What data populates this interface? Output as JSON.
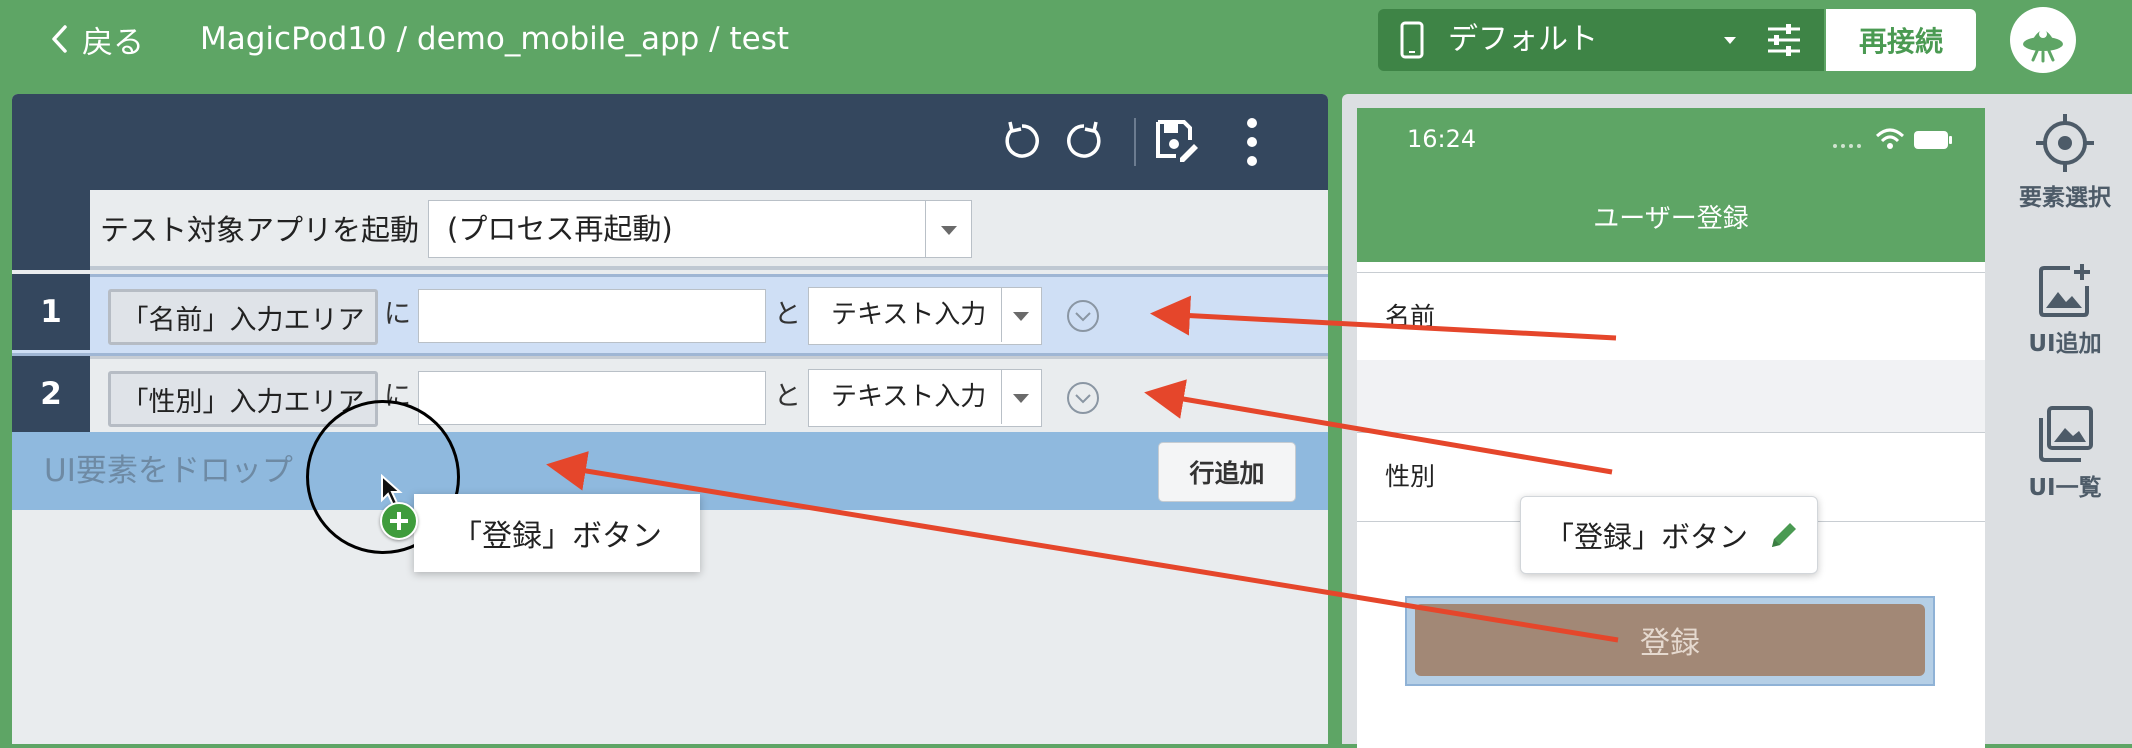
{
  "header": {
    "back_label": "戻る",
    "breadcrumb": "MagicPod10 / demo_mobile_app / test",
    "device_label": "デフォルト",
    "reconnect_label": "再接続"
  },
  "editor": {
    "launch_step": {
      "label": "テスト対象アプリを起動",
      "option": "(プロセス再起動)"
    },
    "steps": [
      {
        "number": "1",
        "element": "「名前」入力エリア",
        "particle_ni": "に",
        "value": "",
        "particle_to": "と",
        "action": "テキスト入力"
      },
      {
        "number": "2",
        "element": "「性別」入力エリア",
        "particle_ni": "に",
        "value": "",
        "particle_to": "と",
        "action": "テキスト入力"
      }
    ],
    "drop_zone_text": "UI要素をドロップ",
    "add_row_label": "行追加",
    "drag_label": "「登録」ボタン"
  },
  "phone": {
    "time": "16:24",
    "nav_title": "ユーザー登録",
    "fields": [
      "名前",
      "性別"
    ],
    "register_button": "登録",
    "tooltip_label": "「登録」ボタン"
  },
  "side_tools": {
    "select": "要素選択",
    "add_ui": "UI追加",
    "ui_list": "UI一覧"
  },
  "colors": {
    "header_green": "#5ea565",
    "toolbar_navy": "#34475e",
    "arrow_red": "#e5462b",
    "drop_zone_blue": "#8fb9de"
  }
}
